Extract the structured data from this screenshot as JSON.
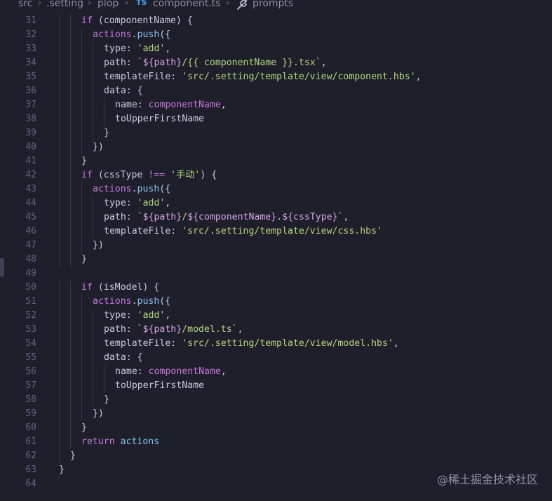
{
  "breadcrumb": {
    "items": [
      {
        "label": "src"
      },
      {
        "label": ".setting"
      },
      {
        "label": "plop"
      },
      {
        "label": "component.ts",
        "badge": "TS"
      },
      {
        "label": "prompts",
        "icon": "wrench-icon"
      }
    ]
  },
  "editor": {
    "lines": [
      {
        "n": "31",
        "indent": 2,
        "tokens": [
          [
            "kw",
            "if"
          ],
          [
            "pl",
            " ("
          ],
          [
            "var",
            "componentName"
          ],
          [
            "pl",
            ") {"
          ]
        ]
      },
      {
        "n": "32",
        "indent": 3,
        "tokens": [
          [
            "kw",
            "actions"
          ],
          [
            "pl",
            "."
          ],
          [
            "fn",
            "push"
          ],
          [
            "pl",
            "({"
          ]
        ]
      },
      {
        "n": "33",
        "indent": 4,
        "tokens": [
          [
            "prop",
            "type"
          ],
          [
            "pl",
            ": "
          ],
          [
            "str",
            "'add'"
          ],
          [
            "pl",
            ","
          ]
        ]
      },
      {
        "n": "34",
        "indent": 4,
        "tokens": [
          [
            "prop",
            "path"
          ],
          [
            "pl",
            ": "
          ],
          [
            "str",
            "`"
          ],
          [
            "tpl",
            "${path}"
          ],
          [
            "str",
            "/{{ componentName }}.tsx`"
          ],
          [
            "pl",
            ","
          ]
        ]
      },
      {
        "n": "35",
        "indent": 4,
        "tokens": [
          [
            "prop",
            "templateFile"
          ],
          [
            "pl",
            ": "
          ],
          [
            "str",
            "'src/.setting/template/view/component.hbs'"
          ],
          [
            "pl",
            ","
          ]
        ]
      },
      {
        "n": "36",
        "indent": 4,
        "tokens": [
          [
            "prop",
            "data"
          ],
          [
            "pl",
            ": {"
          ]
        ]
      },
      {
        "n": "37",
        "indent": 5,
        "tokens": [
          [
            "prop",
            "name"
          ],
          [
            "pl",
            ": "
          ],
          [
            "kw",
            "componentName"
          ],
          [
            "pl",
            ","
          ]
        ]
      },
      {
        "n": "38",
        "indent": 5,
        "tokens": [
          [
            "prop",
            "toUpperFirstName"
          ]
        ]
      },
      {
        "n": "39",
        "indent": 4,
        "tokens": [
          [
            "pl",
            "}"
          ]
        ]
      },
      {
        "n": "40",
        "indent": 3,
        "tokens": [
          [
            "pl",
            "})"
          ]
        ]
      },
      {
        "n": "41",
        "indent": 2,
        "tokens": [
          [
            "pl",
            "}"
          ]
        ]
      },
      {
        "n": "42",
        "indent": 2,
        "tokens": [
          [
            "kw",
            "if"
          ],
          [
            "pl",
            " ("
          ],
          [
            "var",
            "cssType"
          ],
          [
            "op",
            " !== "
          ],
          [
            "str",
            "'手动'"
          ],
          [
            "pl",
            ") {"
          ]
        ]
      },
      {
        "n": "43",
        "indent": 3,
        "tokens": [
          [
            "kw",
            "actions"
          ],
          [
            "pl",
            "."
          ],
          [
            "fn",
            "push"
          ],
          [
            "pl",
            "({"
          ]
        ]
      },
      {
        "n": "44",
        "indent": 4,
        "tokens": [
          [
            "prop",
            "type"
          ],
          [
            "pl",
            ": "
          ],
          [
            "str",
            "'add'"
          ],
          [
            "pl",
            ","
          ]
        ]
      },
      {
        "n": "45",
        "indent": 4,
        "tokens": [
          [
            "prop",
            "path"
          ],
          [
            "pl",
            ": "
          ],
          [
            "str",
            "`"
          ],
          [
            "tpl",
            "${path}"
          ],
          [
            "str",
            "/"
          ],
          [
            "tpl",
            "${componentName}"
          ],
          [
            "str",
            "."
          ],
          [
            "tpl",
            "${cssType}"
          ],
          [
            "str",
            "`"
          ],
          [
            "pl",
            ","
          ]
        ]
      },
      {
        "n": "46",
        "indent": 4,
        "tokens": [
          [
            "prop",
            "templateFile"
          ],
          [
            "pl",
            ": "
          ],
          [
            "str",
            "'src/.setting/template/view/css.hbs'"
          ]
        ]
      },
      {
        "n": "47",
        "indent": 3,
        "tokens": [
          [
            "pl",
            "})"
          ]
        ]
      },
      {
        "n": "48",
        "indent": 2,
        "tokens": [
          [
            "pl",
            "}"
          ]
        ]
      },
      {
        "n": "49",
        "indent": 0,
        "tokens": []
      },
      {
        "n": "50",
        "indent": 2,
        "tokens": [
          [
            "kw",
            "if"
          ],
          [
            "pl",
            " ("
          ],
          [
            "var",
            "isModel"
          ],
          [
            "pl",
            ") {"
          ]
        ]
      },
      {
        "n": "51",
        "indent": 3,
        "tokens": [
          [
            "kw",
            "actions"
          ],
          [
            "pl",
            "."
          ],
          [
            "fn",
            "push"
          ],
          [
            "pl",
            "({"
          ]
        ]
      },
      {
        "n": "52",
        "indent": 4,
        "tokens": [
          [
            "prop",
            "type"
          ],
          [
            "pl",
            ": "
          ],
          [
            "str",
            "'add'"
          ],
          [
            "pl",
            ","
          ]
        ]
      },
      {
        "n": "53",
        "indent": 4,
        "tokens": [
          [
            "prop",
            "path"
          ],
          [
            "pl",
            ": "
          ],
          [
            "str",
            "`"
          ],
          [
            "tpl",
            "${path}"
          ],
          [
            "str",
            "/model.ts`"
          ],
          [
            "pl",
            ","
          ]
        ]
      },
      {
        "n": "54",
        "indent": 4,
        "tokens": [
          [
            "prop",
            "templateFile"
          ],
          [
            "pl",
            ": "
          ],
          [
            "str",
            "'src/.setting/template/view/model.hbs'"
          ],
          [
            "pl",
            ","
          ]
        ]
      },
      {
        "n": "55",
        "indent": 4,
        "tokens": [
          [
            "prop",
            "data"
          ],
          [
            "pl",
            ": {"
          ]
        ]
      },
      {
        "n": "56",
        "indent": 5,
        "tokens": [
          [
            "prop",
            "name"
          ],
          [
            "pl",
            ": "
          ],
          [
            "kw",
            "componentName"
          ],
          [
            "pl",
            ","
          ]
        ]
      },
      {
        "n": "57",
        "indent": 5,
        "tokens": [
          [
            "prop",
            "toUpperFirstName"
          ]
        ]
      },
      {
        "n": "58",
        "indent": 4,
        "tokens": [
          [
            "pl",
            "}"
          ]
        ]
      },
      {
        "n": "59",
        "indent": 3,
        "tokens": [
          [
            "pl",
            "})"
          ]
        ]
      },
      {
        "n": "60",
        "indent": 2,
        "tokens": [
          [
            "pl",
            "}"
          ]
        ]
      },
      {
        "n": "61",
        "indent": 2,
        "tokens": [
          [
            "kw",
            "return"
          ],
          [
            "pl",
            " "
          ],
          [
            "fn",
            "actions"
          ]
        ]
      },
      {
        "n": "62",
        "indent": 1,
        "tokens": [
          [
            "pl",
            "}"
          ]
        ]
      },
      {
        "n": "63",
        "indent": 0,
        "tokens": [
          [
            "pl",
            "}"
          ]
        ]
      },
      {
        "n": "64",
        "indent": 0,
        "tokens": []
      }
    ]
  },
  "watermark": "@稀土掘金技术社区",
  "colors": {
    "background": "#1e1f2b",
    "keyword": "#c678dd",
    "string": "#b5d77c",
    "function": "#89c0f0",
    "line_number": "#5f6584"
  }
}
